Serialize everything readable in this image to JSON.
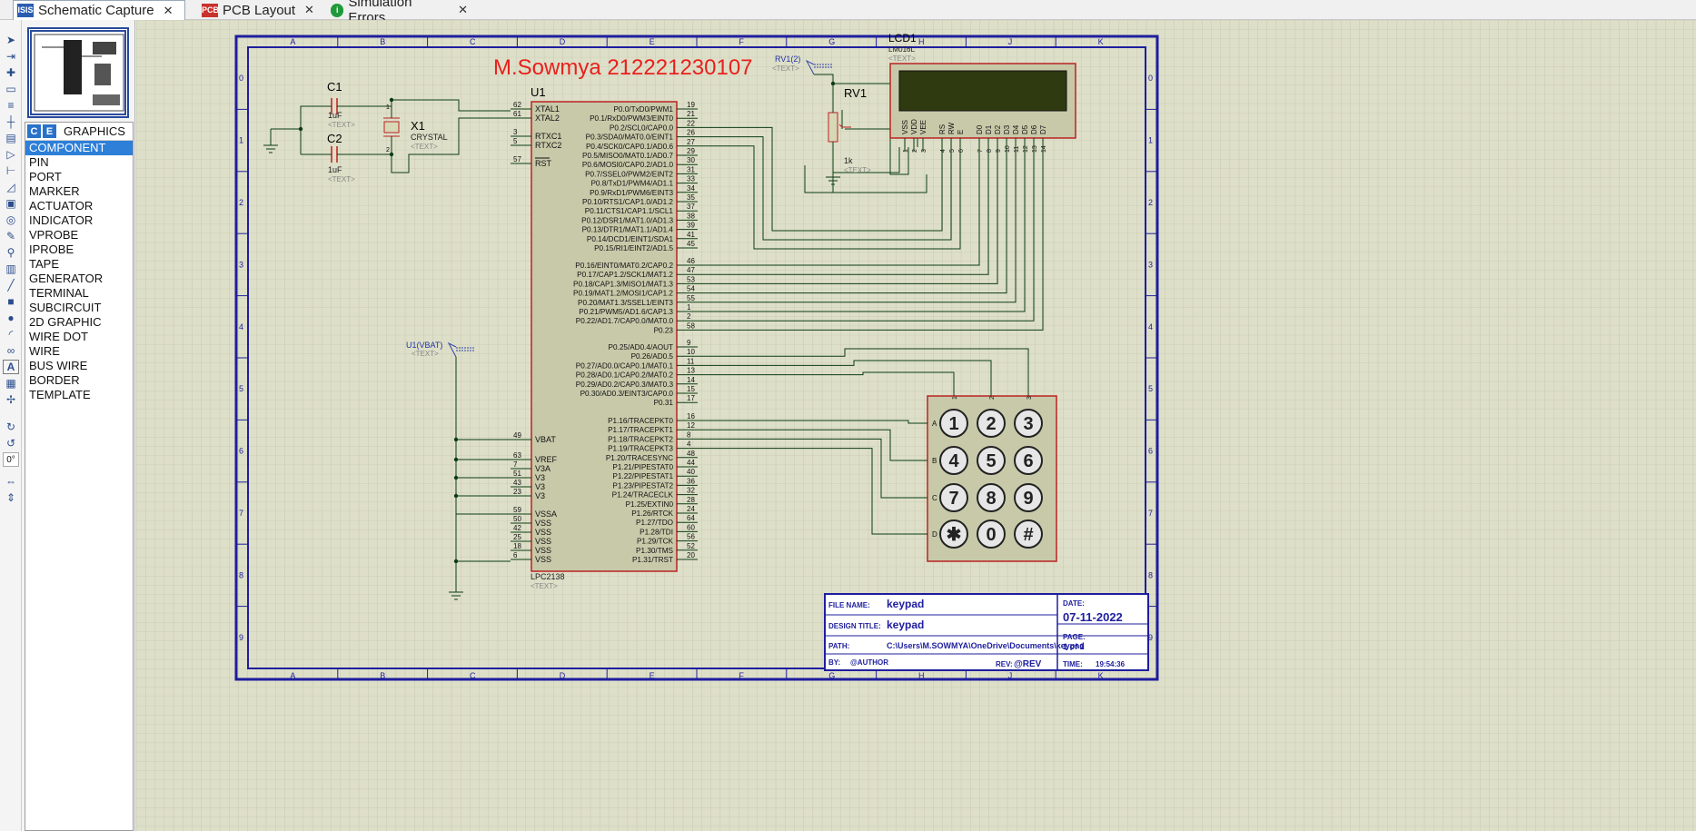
{
  "tabs": [
    {
      "label": "Schematic Capture",
      "icon": "schematic-icon",
      "close": "✕"
    },
    {
      "label": "PCB Layout",
      "icon": "pcb-icon",
      "close": "✕"
    },
    {
      "label": "Simulation Errors",
      "icon": "info-icon",
      "close": "✕"
    }
  ],
  "selector": {
    "modes": [
      "C",
      "E"
    ],
    "header": "GRAPHICS",
    "items": [
      "COMPONENT",
      "PIN",
      "PORT",
      "MARKER",
      "ACTUATOR",
      "INDICATOR",
      "VPROBE",
      "IPROBE",
      "TAPE",
      "GENERATOR",
      "TERMINAL",
      "SUBCIRCUIT",
      "2D GRAPHIC",
      "WIRE DOT",
      "WIRE",
      "BUS WIRE",
      "BORDER",
      "TEMPLATE"
    ],
    "selected": "COMPONENT"
  },
  "rotation": "0°",
  "sheet": {
    "columns": [
      "A",
      "B",
      "C",
      "D",
      "E",
      "F",
      "G",
      "H",
      "J",
      "K"
    ],
    "rows": [
      "0",
      "1",
      "2",
      "3",
      "4",
      "5",
      "6",
      "7",
      "8",
      "9"
    ],
    "title_text": "M.Sowmya 212221230107",
    "title_color": "#e8201c"
  },
  "parts": {
    "u1_ref": "U1",
    "u1_value": "LPC2138",
    "text_ph": "<TEXT>",
    "c1_ref": "C1",
    "c1_value": "1uF",
    "c2_ref": "C2",
    "c2_value": "1uF",
    "x1_ref": "X1",
    "x1_value": "CRYSTAL",
    "rv1_ref": "RV1",
    "rv1_value": "1k",
    "rv1_probe": "RV1(2)",
    "vbat_probe": "U1(VBAT)",
    "lcd_ref": "LCD1",
    "lcd_value": "LM016L"
  },
  "u1_left_pins": [
    {
      "name": "XTAL1",
      "num": "62"
    },
    {
      "name": "XTAL2",
      "num": "61"
    },
    {
      "name": "RTXC1",
      "num": "3"
    },
    {
      "name": "RTXC2",
      "num": "5"
    },
    {
      "name": "RST",
      "num": "57"
    },
    {
      "name": "VBAT",
      "num": "49"
    },
    {
      "name": "VREF",
      "num": "63"
    },
    {
      "name": "V3A",
      "num": "7"
    },
    {
      "name": "V3",
      "num": "51"
    },
    {
      "name": "V3",
      "num": "43"
    },
    {
      "name": "V3",
      "num": "23"
    },
    {
      "name": "VSSA",
      "num": "59"
    },
    {
      "name": "VSS",
      "num": "50"
    },
    {
      "name": "VSS",
      "num": "42"
    },
    {
      "name": "VSS",
      "num": "25"
    },
    {
      "name": "VSS",
      "num": "18"
    },
    {
      "name": "VSS",
      "num": "6"
    }
  ],
  "u1_right_pins": [
    {
      "name": "P0.0/TxD0/PWM1",
      "num": "19"
    },
    {
      "name": "P0.1/RxD0/PWM3/EINT0",
      "num": "21"
    },
    {
      "name": "P0.2/SCL0/CAP0.0",
      "num": "22"
    },
    {
      "name": "P0.3/SDA0/MAT0.0/EINT1",
      "num": "26"
    },
    {
      "name": "P0.4/SCK0/CAP0.1/AD0.6",
      "num": "27"
    },
    {
      "name": "P0.5/MISO0/MAT0.1/AD0.7",
      "num": "29"
    },
    {
      "name": "P0.6/MOSI0/CAP0.2/AD1.0",
      "num": "30"
    },
    {
      "name": "P0.7/SSEL0/PWM2/EINT2",
      "num": "31"
    },
    {
      "name": "P0.8/TxD1/PWM4/AD1.1",
      "num": "33"
    },
    {
      "name": "P0.9/RxD1/PWM6/EINT3",
      "num": "34"
    },
    {
      "name": "P0.10/RTS1/CAP1.0/AD1.2",
      "num": "35"
    },
    {
      "name": "P0.11/CTS1/CAP1.1/SCL1",
      "num": "37"
    },
    {
      "name": "P0.12/DSR1/MAT1.0/AD1.3",
      "num": "38"
    },
    {
      "name": "P0.13/DTR1/MAT1.1/AD1.4",
      "num": "39"
    },
    {
      "name": "P0.14/DCD1/EINT1/SDA1",
      "num": "41"
    },
    {
      "name": "P0.15/RI1/EINT2/AD1.5",
      "num": "45"
    },
    {
      "name": "P0.16/EINT0/MAT0.2/CAP0.2",
      "num": "46"
    },
    {
      "name": "P0.17/CAP1.2/SCK1/MAT1.2",
      "num": "47"
    },
    {
      "name": "P0.18/CAP1.3/MISO1/MAT1.3",
      "num": "53"
    },
    {
      "name": "P0.19/MAT1.2/MOSI1/CAP1.2",
      "num": "54"
    },
    {
      "name": "P0.20/MAT1.3/SSEL1/EINT3",
      "num": "55"
    },
    {
      "name": "P0.21/PWM5/AD1.6/CAP1.3",
      "num": "1"
    },
    {
      "name": "P0.22/AD1.7/CAP0.0/MAT0.0",
      "num": "2"
    },
    {
      "name": "P0.23",
      "num": "58"
    },
    {
      "name": "P0.25/AD0.4/AOUT",
      "num": "9"
    },
    {
      "name": "P0.26/AD0.5",
      "num": "10"
    },
    {
      "name": "P0.27/AD0.0/CAP0.1/MAT0.1",
      "num": "11"
    },
    {
      "name": "P0.28/AD0.1/CAP0.2/MAT0.2",
      "num": "13"
    },
    {
      "name": "P0.29/AD0.2/CAP0.3/MAT0.3",
      "num": "14"
    },
    {
      "name": "P0.30/AD0.3/EINT3/CAP0.0",
      "num": "15"
    },
    {
      "name": "P0.31",
      "num": "17"
    },
    {
      "name": "P1.16/TRACEPKT0",
      "num": "16"
    },
    {
      "name": "P1.17/TRACEPKT1",
      "num": "12"
    },
    {
      "name": "P1.18/TRACEPKT2",
      "num": "8"
    },
    {
      "name": "P1.19/TRACEPKT3",
      "num": "4"
    },
    {
      "name": "P1.20/TRACESYNC",
      "num": "48"
    },
    {
      "name": "P1.21/PIPESTAT0",
      "num": "44"
    },
    {
      "name": "P1.22/PIPESTAT1",
      "num": "40"
    },
    {
      "name": "P1.23/PIPESTAT2",
      "num": "36"
    },
    {
      "name": "P1.24/TRACECLK",
      "num": "32"
    },
    {
      "name": "P1.25/EXTIN0",
      "num": "28"
    },
    {
      "name": "P1.26/RTCK",
      "num": "24"
    },
    {
      "name": "P1.27/TDO",
      "num": "64"
    },
    {
      "name": "P1.28/TDI",
      "num": "60"
    },
    {
      "name": "P1.29/TCK",
      "num": "56"
    },
    {
      "name": "P1.30/TMS",
      "num": "52"
    },
    {
      "name": "P1.31/TRST",
      "num": "20"
    }
  ],
  "lcd_pins": [
    {
      "name": "VSS",
      "num": "1"
    },
    {
      "name": "VDD",
      "num": "2"
    },
    {
      "name": "VEE",
      "num": "3"
    },
    {
      "name": "RS",
      "num": "4"
    },
    {
      "name": "RW",
      "num": "5"
    },
    {
      "name": "E",
      "num": "6"
    },
    {
      "name": "D0",
      "num": "7"
    },
    {
      "name": "D1",
      "num": "8"
    },
    {
      "name": "D2",
      "num": "9"
    },
    {
      "name": "D3",
      "num": "10"
    },
    {
      "name": "D4",
      "num": "11"
    },
    {
      "name": "D5",
      "num": "12"
    },
    {
      "name": "D6",
      "num": "13"
    },
    {
      "name": "D7",
      "num": "14"
    }
  ],
  "keypad": {
    "keys": [
      "1",
      "2",
      "3",
      "4",
      "5",
      "6",
      "7",
      "8",
      "9",
      "✱",
      "0",
      "#"
    ],
    "rows": [
      "A",
      "B",
      "C",
      "D"
    ],
    "cols": [
      "1",
      "2",
      "3"
    ]
  },
  "titleblock": {
    "file_label": "FILE NAME:",
    "file_value": "keypad",
    "design_label": "DESIGN TITLE:",
    "design_value": "keypad",
    "path_label": "PATH:",
    "path_value": "C:\\Users\\M.SOWMYA\\OneDrive\\Documents\\keypad",
    "by_label": "BY:",
    "by_value": "@AUTHOR",
    "rev_label": "REV:",
    "rev_value": "@REV",
    "date_label": "DATE:",
    "date_value": "07-11-2022",
    "page_label": "PAGE:",
    "page_value": "1 of 1",
    "time_label": "TIME:",
    "time_value": "19:54:36"
  }
}
